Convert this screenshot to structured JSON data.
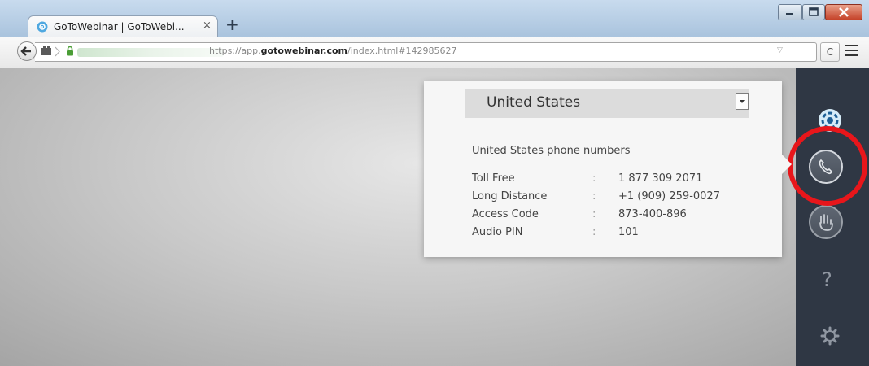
{
  "browser": {
    "tab_title": "GoToWebinar | GoToWebi...",
    "tab_close": "×",
    "new_tab": "+",
    "url_prefix": "https://app.",
    "url_domain": "gotowebinar.com",
    "url_path": "/index.html#142985627",
    "reload": "C"
  },
  "audio_panel": {
    "country": "United States",
    "numbers_heading": "United States phone numbers",
    "rows": [
      {
        "label": "Toll Free",
        "colon": ":",
        "value": "1 877 309 2071"
      },
      {
        "label": "Long Distance",
        "colon": ":",
        "value": "+1 (909) 259-0027"
      },
      {
        "label": "Access Code",
        "colon": ":",
        "value": "873-400-896"
      },
      {
        "label": "Audio PIN",
        "colon": ":",
        "value": "101"
      }
    ]
  },
  "sidebar": {
    "help": "?"
  },
  "colors": {
    "sidebar_bg": "#2f3744",
    "highlight_ring": "#e8161b",
    "panel_bg": "#f6f6f6"
  },
  "icons": [
    "gotowebinar-favicon-icon",
    "back-arrow-icon",
    "identity-icon",
    "lock-icon",
    "reload-icon",
    "menu-icon",
    "gotowebinar-logo-icon",
    "phone-icon",
    "raise-hand-icon",
    "help-icon",
    "gear-icon"
  ]
}
